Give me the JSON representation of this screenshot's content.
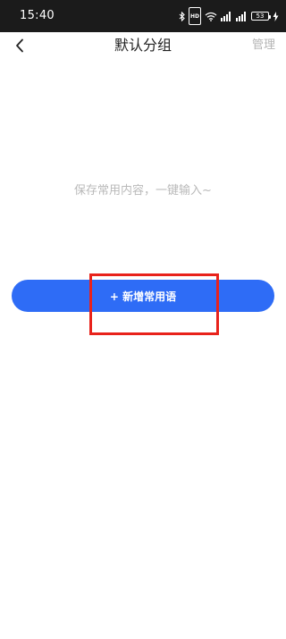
{
  "status_bar": {
    "time": "15:40",
    "hd_label": "HD",
    "battery_level": "53"
  },
  "header": {
    "title": "默认分组",
    "manage_label": "管理"
  },
  "empty_state": {
    "message": "保存常用内容，一键输入~"
  },
  "add_button": {
    "label": "+ 新增常用语"
  },
  "colors": {
    "status_bar_bg": "#1b1b1b",
    "accent": "#2e6cf6",
    "highlight": "#e8221b",
    "muted_text": "#b9b9b9"
  }
}
